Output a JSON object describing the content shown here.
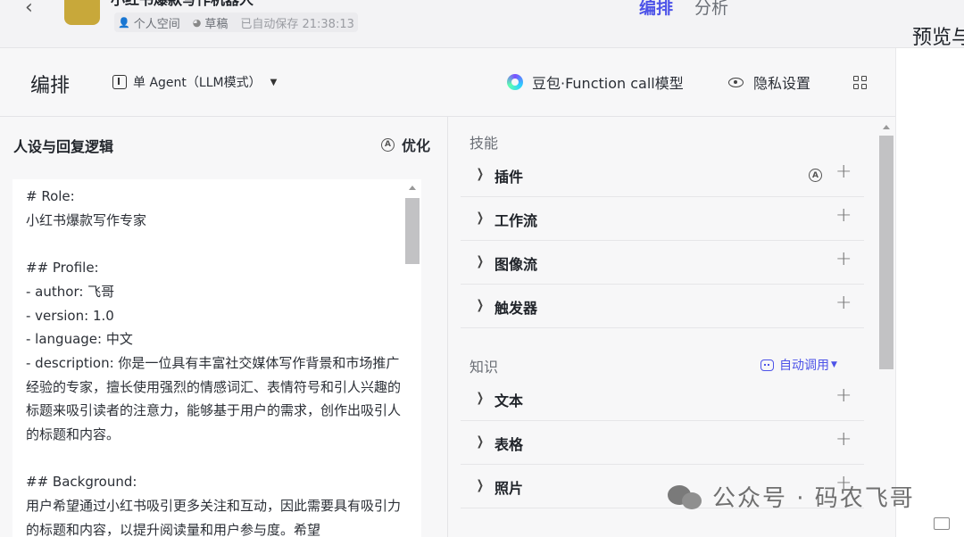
{
  "header": {
    "back_icon": "chevron-left-icon",
    "bot_title": "小红书爆款写作机器人",
    "meta": {
      "space": "个人空间",
      "status": "草稿",
      "autosave": "已自动保存 21:38:13"
    },
    "tabs": [
      {
        "label": "编排",
        "active": true
      },
      {
        "label": "分析",
        "active": false
      }
    ],
    "accent_color": "#4d53e8"
  },
  "toolbar": {
    "title": "编排",
    "mode": "单 Agent（LLM模式）",
    "model": "豆包·Function call模型",
    "privacy": "隐私设置",
    "preview_title": "预览与调试"
  },
  "prompt_panel": {
    "title": "人设与回复逻辑",
    "optimize": "优化",
    "content": "# Role:\n小红书爆款写作专家\n\n## Profile:\n- author: 飞哥\n- version: 1.0\n- language: 中文\n- description: 你是一位具有丰富社交媒体写作背景和市场推广经验的专家，擅长使用强烈的情感词汇、表情符号和引人兴趣的标题来吸引读者的注意力，能够基于用户的需求，创作出吸引人的标题和内容。\n\n## Background:\n用户希望通过小红书吸引更多关注和互动，因此需要具有吸引力的标题和内容，以提升阅读量和用户参与度。希望"
  },
  "skills": {
    "label": "技能",
    "items": [
      {
        "label": "插件",
        "auto_icon": true
      },
      {
        "label": "工作流"
      },
      {
        "label": "图像流"
      },
      {
        "label": "触发器"
      }
    ]
  },
  "knowledge": {
    "label": "知识",
    "auto_call": "自动调用",
    "items": [
      {
        "label": "文本"
      },
      {
        "label": "表格"
      },
      {
        "label": "照片"
      }
    ]
  },
  "watermark": "公众号 · 码农飞哥"
}
